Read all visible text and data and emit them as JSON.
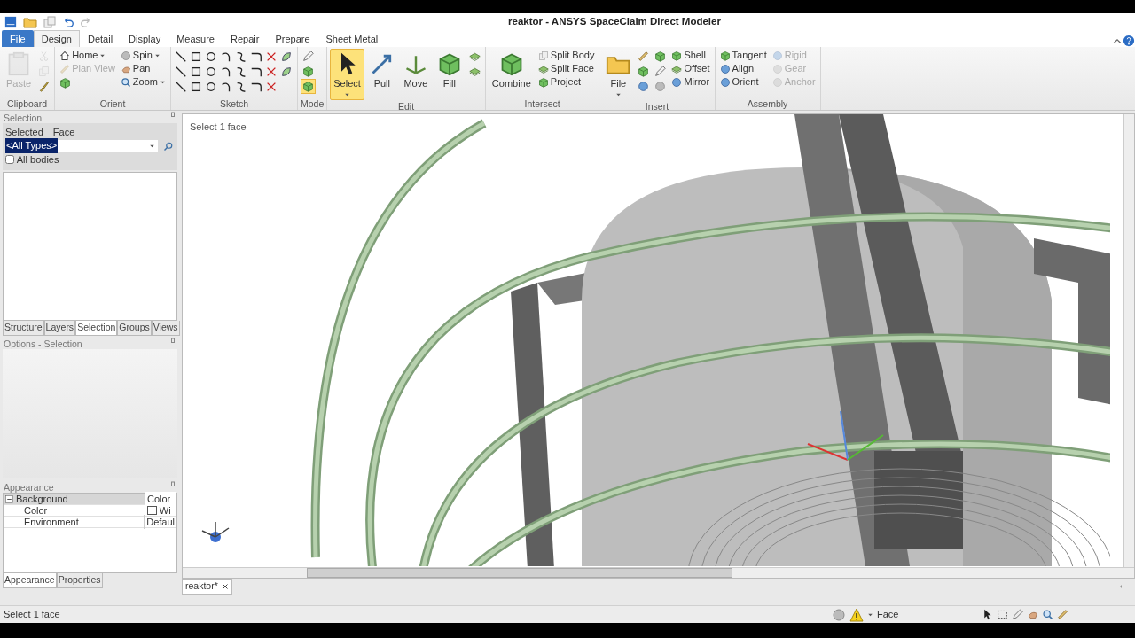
{
  "window": {
    "title": "reaktor - ANSYS SpaceClaim Direct Modeler"
  },
  "tabs": [
    {
      "label": "File",
      "kind": "file",
      "selected": false
    },
    {
      "label": "Design",
      "kind": "tab",
      "selected": true
    },
    {
      "label": "Detail",
      "kind": "tab",
      "selected": false
    },
    {
      "label": "Display",
      "kind": "tab",
      "selected": false
    },
    {
      "label": "Measure",
      "kind": "tab",
      "selected": false
    },
    {
      "label": "Repair",
      "kind": "tab",
      "selected": false
    },
    {
      "label": "Prepare",
      "kind": "tab",
      "selected": false
    },
    {
      "label": "Sheet Metal",
      "kind": "tab",
      "selected": false
    }
  ],
  "ribbon": {
    "groups": [
      {
        "label": "Clipboard",
        "items": [
          {
            "kind": "large",
            "label": "Paste",
            "disabled": true,
            "selected": false,
            "dropdown": false
          },
          {
            "kind": "icon",
            "disabled": true,
            "selected": false
          },
          {
            "kind": "icon",
            "disabled": true,
            "selected": false
          },
          {
            "kind": "icon",
            "disabled": false,
            "selected": false
          }
        ]
      },
      {
        "label": "Orient",
        "items": [
          {
            "kind": "small",
            "label": "Home",
            "disabled": false,
            "dropdown": true
          },
          {
            "kind": "small",
            "label": "Plan View",
            "disabled": true,
            "dropdown": false
          },
          {
            "kind": "icon",
            "disabled": false,
            "selected": false
          },
          {
            "kind": "small",
            "label": "Spin",
            "disabled": false,
            "dropdown": true
          },
          {
            "kind": "small",
            "label": "Pan",
            "disabled": false,
            "dropdown": false
          },
          {
            "kind": "small",
            "label": "Zoom",
            "disabled": false,
            "dropdown": true
          }
        ]
      },
      {
        "label": "Sketch",
        "items": [
          {
            "kind": "icon",
            "disabled": false,
            "selected": false
          },
          {
            "kind": "icon",
            "disabled": false,
            "selected": false
          },
          {
            "kind": "icon",
            "disabled": false,
            "selected": false
          },
          {
            "kind": "icon",
            "disabled": false,
            "selected": false
          },
          {
            "kind": "icon",
            "disabled": false,
            "selected": false
          },
          {
            "kind": "icon",
            "disabled": false,
            "selected": false
          },
          {
            "kind": "icon",
            "disabled": false,
            "selected": false
          },
          {
            "kind": "icon",
            "disabled": false,
            "selected": false
          },
          {
            "kind": "icon",
            "disabled": false,
            "selected": false
          },
          {
            "kind": "icon",
            "disabled": false,
            "selected": false
          },
          {
            "kind": "icon",
            "disabled": false,
            "selected": false
          },
          {
            "kind": "icon",
            "disabled": false,
            "selected": false
          },
          {
            "kind": "icon",
            "disabled": false,
            "selected": false
          },
          {
            "kind": "icon",
            "disabled": false,
            "selected": false
          },
          {
            "kind": "icon",
            "disabled": false,
            "selected": false
          },
          {
            "kind": "icon",
            "disabled": false,
            "selected": false
          },
          {
            "kind": "icon",
            "disabled": false,
            "selected": false
          },
          {
            "kind": "icon",
            "disabled": false,
            "selected": false
          },
          {
            "kind": "icon",
            "disabled": false,
            "selected": false
          },
          {
            "kind": "icon",
            "disabled": false,
            "selected": false
          },
          {
            "kind": "icon",
            "disabled": false,
            "selected": false
          },
          {
            "kind": "icon",
            "disabled": false,
            "selected": false
          },
          {
            "kind": "icon",
            "disabled": false,
            "selected": false
          }
        ]
      },
      {
        "label": "Mode",
        "items": [
          {
            "kind": "icon",
            "disabled": false,
            "selected": false
          },
          {
            "kind": "icon",
            "disabled": false,
            "selected": false
          },
          {
            "kind": "icon",
            "disabled": false,
            "selected": true
          }
        ]
      },
      {
        "label": "Edit",
        "items": [
          {
            "kind": "large",
            "label": "Select",
            "disabled": false,
            "selected": true,
            "dropdown": true
          },
          {
            "kind": "large",
            "label": "Pull",
            "disabled": false,
            "selected": false,
            "dropdown": false
          },
          {
            "kind": "large",
            "label": "Move",
            "disabled": false,
            "selected": false,
            "dropdown": false
          },
          {
            "kind": "large",
            "label": "Fill",
            "disabled": false,
            "selected": false,
            "dropdown": false
          },
          {
            "kind": "icon",
            "disabled": false,
            "selected": false
          },
          {
            "kind": "icon",
            "disabled": false,
            "selected": false
          }
        ]
      },
      {
        "label": "Intersect",
        "items": [
          {
            "kind": "large",
            "label": "Combine",
            "disabled": false,
            "selected": false,
            "dropdown": false
          },
          {
            "kind": "small",
            "label": "Split Body",
            "disabled": false,
            "dropdown": false
          },
          {
            "kind": "small",
            "label": "Split Face",
            "disabled": false,
            "dropdown": false
          },
          {
            "kind": "small",
            "label": "Project",
            "disabled": false,
            "dropdown": false
          }
        ]
      },
      {
        "label": "Insert",
        "items": [
          {
            "kind": "large",
            "label": "File",
            "disabled": false,
            "selected": false,
            "dropdown": true
          },
          {
            "kind": "icon",
            "disabled": false,
            "selected": false
          },
          {
            "kind": "icon",
            "disabled": false,
            "selected": false
          },
          {
            "kind": "icon",
            "disabled": false,
            "selected": false
          },
          {
            "kind": "icon",
            "disabled": false,
            "selected": false
          },
          {
            "kind": "icon",
            "disabled": false,
            "selected": false
          },
          {
            "kind": "icon",
            "disabled": false,
            "selected": false
          },
          {
            "kind": "small",
            "label": "Shell",
            "disabled": false,
            "dropdown": false
          },
          {
            "kind": "small",
            "label": "Offset",
            "disabled": false,
            "dropdown": false
          },
          {
            "kind": "small",
            "label": "Mirror",
            "disabled": false,
            "dropdown": false
          }
        ]
      },
      {
        "label": "Assembly",
        "items": [
          {
            "kind": "small",
            "label": "Tangent",
            "disabled": false,
            "dropdown": false
          },
          {
            "kind": "small",
            "label": "Align",
            "disabled": false,
            "dropdown": false
          },
          {
            "kind": "small",
            "label": "Orient",
            "disabled": false,
            "dropdown": false
          },
          {
            "kind": "small",
            "label": "Rigid",
            "disabled": true,
            "dropdown": false
          },
          {
            "kind": "small",
            "label": "Gear",
            "disabled": true,
            "dropdown": false
          },
          {
            "kind": "small",
            "label": "Anchor",
            "disabled": true,
            "dropdown": false
          }
        ]
      }
    ]
  },
  "selection_panel": {
    "title": "Selection",
    "selected_label": "Selected",
    "selected_value": "Face",
    "type_value": "<All Types>",
    "all_bodies": {
      "label": "All bodies",
      "checked": false
    }
  },
  "panel_tabs": [
    {
      "label": "Structure",
      "selected": false
    },
    {
      "label": "Layers",
      "selected": false
    },
    {
      "label": "Selection",
      "selected": true
    },
    {
      "label": "Groups",
      "selected": false
    },
    {
      "label": "Views",
      "selected": false
    }
  ],
  "options_panel": {
    "title": "Options - Selection"
  },
  "appearance_panel": {
    "title": "Appearance",
    "rows": [
      {
        "name": "Background",
        "value": "Color",
        "expanded": true,
        "children": [
          {
            "name": "Color",
            "value": "Wi",
            "kind": "color"
          },
          {
            "name": "Environment",
            "value": "Defaul",
            "kind": "text"
          }
        ]
      }
    ]
  },
  "appearance_tabs": [
    {
      "label": "Appearance",
      "selected": true
    },
    {
      "label": "Properties",
      "selected": false
    }
  ],
  "viewport": {
    "hint": "Select 1 face"
  },
  "doc_tabs": [
    {
      "label": "reaktor*",
      "selected": true
    }
  ],
  "status_bar": {
    "message": "Select 1 face",
    "mode": "Face"
  }
}
